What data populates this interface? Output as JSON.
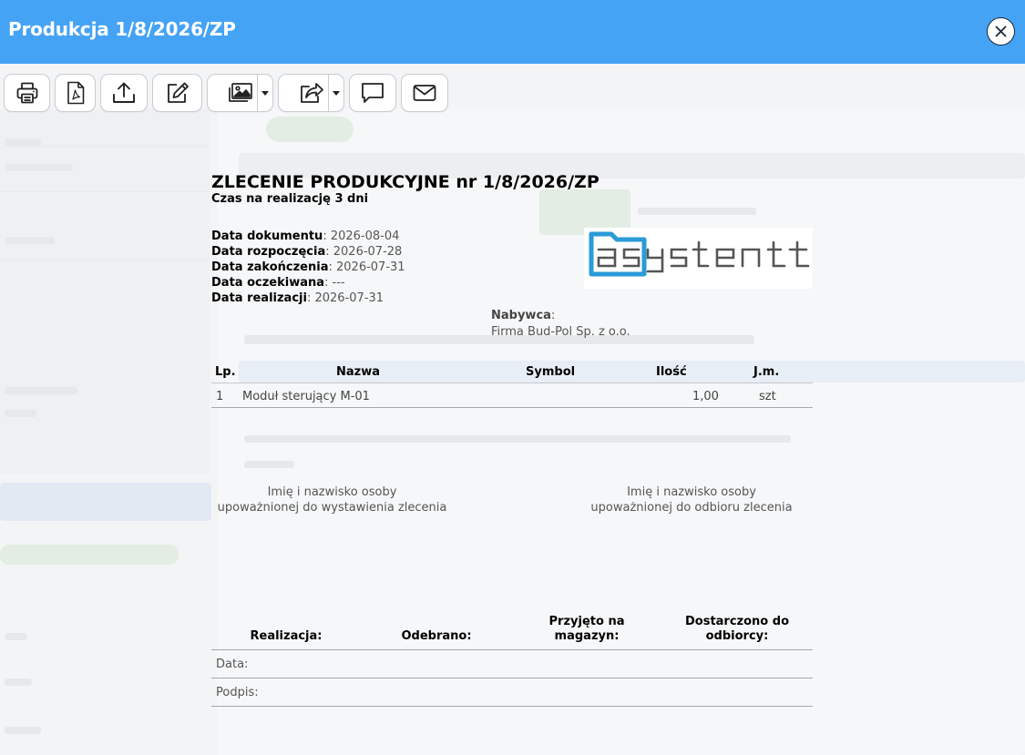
{
  "window": {
    "title": "Produkcja 1/8/2026/ZP"
  },
  "toolbar": {
    "buttons": [
      "print-icon",
      "pdf-icon",
      "upload-icon",
      "edit-icon",
      "gallery-icon",
      "share-icon",
      "comment-icon",
      "mail-icon"
    ]
  },
  "colors": {
    "titlebar": "#45a3f5",
    "logo_blue": "#2a9ad8",
    "logo_gray": "#555555"
  },
  "document": {
    "title": "ZLECENIE PRODUKCYJNE nr 1/8/2026/ZP",
    "subtitle": "Czas na realizację 3 dni",
    "dates": [
      {
        "label": "Data dokumentu",
        "value": "2026-08-04"
      },
      {
        "label": "Data rozpoczęcia",
        "value": "2026-07-28"
      },
      {
        "label": "Data zakończenia",
        "value": "2026-07-31"
      },
      {
        "label": "Data oczekiwana",
        "value": "---"
      },
      {
        "label": "Data realizacji",
        "value": "2026-07-31"
      }
    ],
    "buyer": {
      "label": "Nabywca",
      "value": "Firma Bud-Pol Sp. z o.o."
    },
    "logo_text": "asystent",
    "items": {
      "columns": [
        "Lp.",
        "Nazwa",
        "Symbol",
        "Ilość",
        "J.m."
      ],
      "rows": [
        {
          "lp": "1",
          "name": "Moduł sterujący M-01",
          "symbol": "",
          "qty": "1,00",
          "unit": "szt"
        }
      ]
    },
    "signatures": {
      "issuer": [
        "Imię i nazwisko osoby",
        "upoważnionej do wystawienia zlecenia"
      ],
      "receiver": [
        "Imię i nazwisko osoby",
        "upoważnionej do odbioru zlecenia"
      ]
    },
    "footer": {
      "columns": [
        [
          "Realizacja:"
        ],
        [
          "Odebrano:"
        ],
        [
          "Przyjęto na",
          "magazyn:"
        ],
        [
          "Dostarczono do",
          "odbiorcy:"
        ]
      ],
      "rows": [
        "Data:",
        "Podpis:"
      ]
    }
  }
}
